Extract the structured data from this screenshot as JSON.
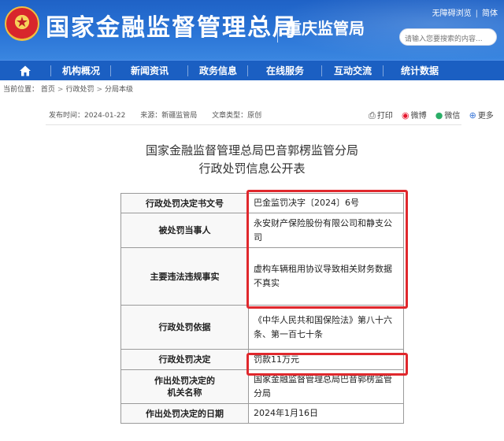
{
  "header": {
    "site_title": "国家金融监督管理总局",
    "bureau": "重庆监管局",
    "emblem_glyph": "★",
    "top_links": [
      "无障碍浏览",
      "简体"
    ],
    "search_placeholder": "请输入您要搜索的内容..."
  },
  "nav": {
    "items": [
      "机构概况",
      "新闻资讯",
      "政务信息",
      "在线服务",
      "互动交流",
      "统计数据"
    ]
  },
  "breadcrumb": {
    "prefix": "当前位置：",
    "items": [
      "首页",
      "行政处罚",
      "分局本级"
    ]
  },
  "meta": {
    "publish_time": "发布时间：2024-01-22",
    "source": "来源：新疆监管局",
    "type": "文章类型：原创"
  },
  "share": {
    "print": "打印",
    "weibo": "微博",
    "wechat": "微信",
    "more": "更多"
  },
  "document": {
    "title_line1": "国家金融监督管理总局巴音郭楞监管分局",
    "title_line2": "行政处罚信息公开表"
  },
  "table": {
    "rows": [
      {
        "label": "行政处罚决定书文号",
        "value": "巴金监罚决字〔2024〕6号"
      },
      {
        "label": "被处罚当事人",
        "value": "永安财产保险股份有限公司和静支公司"
      },
      {
        "label": "主要违法违规事实",
        "value": "虚构车辆租用协议导致相关财务数据不真实"
      },
      {
        "label": "行政处罚依据",
        "value": "《中华人民共和国保险法》第八十六条、第一百七十条"
      },
      {
        "label": "行政处罚决定",
        "value": "罚款11万元"
      },
      {
        "label_line1": "作出处罚决定的",
        "label_line2": "机关名称",
        "value": "国家金融监督管理总局巴音郭楞监管分局"
      },
      {
        "label": "作出处罚决定的日期",
        "value": "2024年1月16日"
      }
    ]
  },
  "colors": {
    "header_blue": "#2a74d6",
    "nav_blue": "#1b5fc2",
    "highlight_red": "#e0282d"
  },
  "icons": [
    "home-icon",
    "print-icon",
    "weibo-icon",
    "wechat-icon",
    "more-icon",
    "emblem-icon"
  ]
}
